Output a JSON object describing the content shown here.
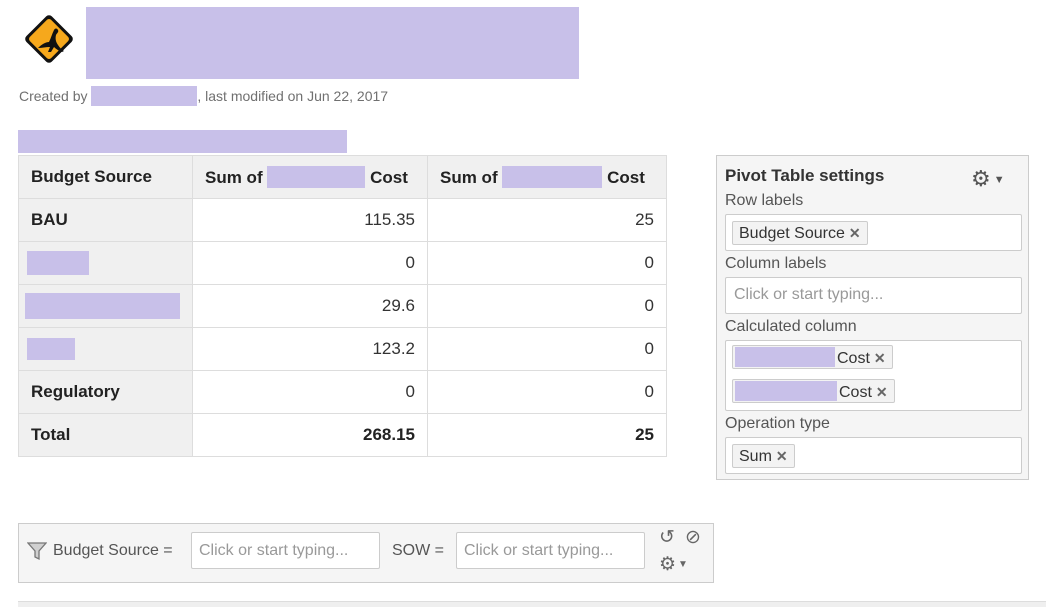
{
  "page": {
    "byline_prefix": "Created by",
    "byline_suffix": ", last modified on Jun 22, 2017"
  },
  "pivot": {
    "headers": [
      "Budget Source",
      "Sum of",
      "Cost",
      "Sum of",
      "Cost"
    ],
    "rows": [
      {
        "label": "BAU",
        "v1": "115.35",
        "v2": "25"
      },
      {
        "label": "",
        "v1": "0",
        "v2": "0"
      },
      {
        "label": "",
        "v1": "29.6",
        "v2": "0"
      },
      {
        "label": "",
        "v1": "123.2",
        "v2": "0"
      },
      {
        "label": "Regulatory",
        "v1": "0",
        "v2": "0"
      }
    ],
    "total": {
      "label": "Total",
      "v1": "268.15",
      "v2": "25"
    }
  },
  "settings": {
    "title": "Pivot Table settings",
    "row_labels": "Row labels",
    "row_chip": "Budget Source",
    "column_labels": "Column labels",
    "column_placeholder": "Click or start typing...",
    "calculated_column": "Calculated column",
    "calc_chip_1": "Cost",
    "calc_chip_2": "Cost",
    "operation_type": "Operation type",
    "operation_chip": "Sum",
    "remove_glyph": "✕"
  },
  "filters": {
    "budget_source_label": "Budget Source =",
    "sow_label": "SOW =",
    "placeholder": "Click or start typing..."
  }
}
